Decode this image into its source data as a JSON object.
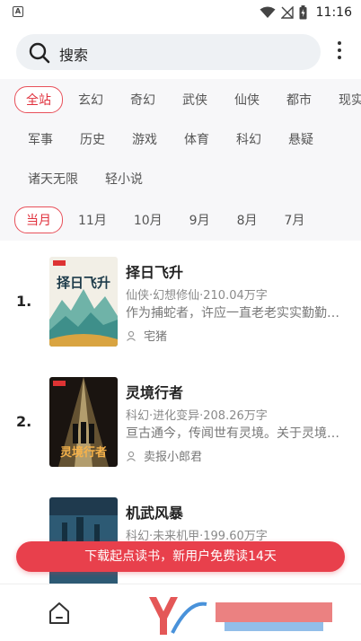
{
  "status_bar": {
    "left_icon_letter": "A",
    "time": "11:16"
  },
  "search": {
    "label": "搜索"
  },
  "category_chips": [
    {
      "label": "全站",
      "active": true
    },
    {
      "label": "玄幻",
      "active": false
    },
    {
      "label": "奇幻",
      "active": false
    },
    {
      "label": "武侠",
      "active": false
    },
    {
      "label": "仙侠",
      "active": false
    },
    {
      "label": "都市",
      "active": false
    },
    {
      "label": "现实",
      "active": false
    },
    {
      "label": "军事",
      "active": false
    },
    {
      "label": "历史",
      "active": false
    },
    {
      "label": "游戏",
      "active": false
    },
    {
      "label": "体育",
      "active": false
    },
    {
      "label": "科幻",
      "active": false
    },
    {
      "label": "悬疑",
      "active": false
    },
    {
      "label": "诸天无限",
      "active": false
    },
    {
      "label": "轻小说",
      "active": false
    }
  ],
  "month_chips": [
    {
      "label": "当月",
      "active": true
    },
    {
      "label": "11月",
      "active": false
    },
    {
      "label": "10月",
      "active": false
    },
    {
      "label": "9月",
      "active": false
    },
    {
      "label": "8月",
      "active": false
    },
    {
      "label": "7月",
      "active": false
    }
  ],
  "books": [
    {
      "rank": "1.",
      "title": "择日飞升",
      "meta": "仙侠·幻想修仙·210.04万字",
      "description": "作为捕蛇者，许应一直老老实实勤勤恳恳",
      "author": "宅猪",
      "cover_text": "择日飞升"
    },
    {
      "rank": "2.",
      "title": "灵境行者",
      "meta": "科幻·进化变异·208.26万字",
      "description": "亘古通今，传闻世有灵境。关于灵境的传说",
      "author": "卖报小郎君",
      "cover_text": "灵境行者"
    },
    {
      "rank": "",
      "title": "机武风暴",
      "meta": "科幻·未来机甲·199.60万字",
      "description": "",
      "author": "",
      "cover_text": ""
    }
  ],
  "download_banner": "下载起点读书，新用户免费读14天",
  "colors": {
    "accent": "#e8404c",
    "filter_bg": "#f7f7f9",
    "search_bg": "#eef1f4"
  }
}
